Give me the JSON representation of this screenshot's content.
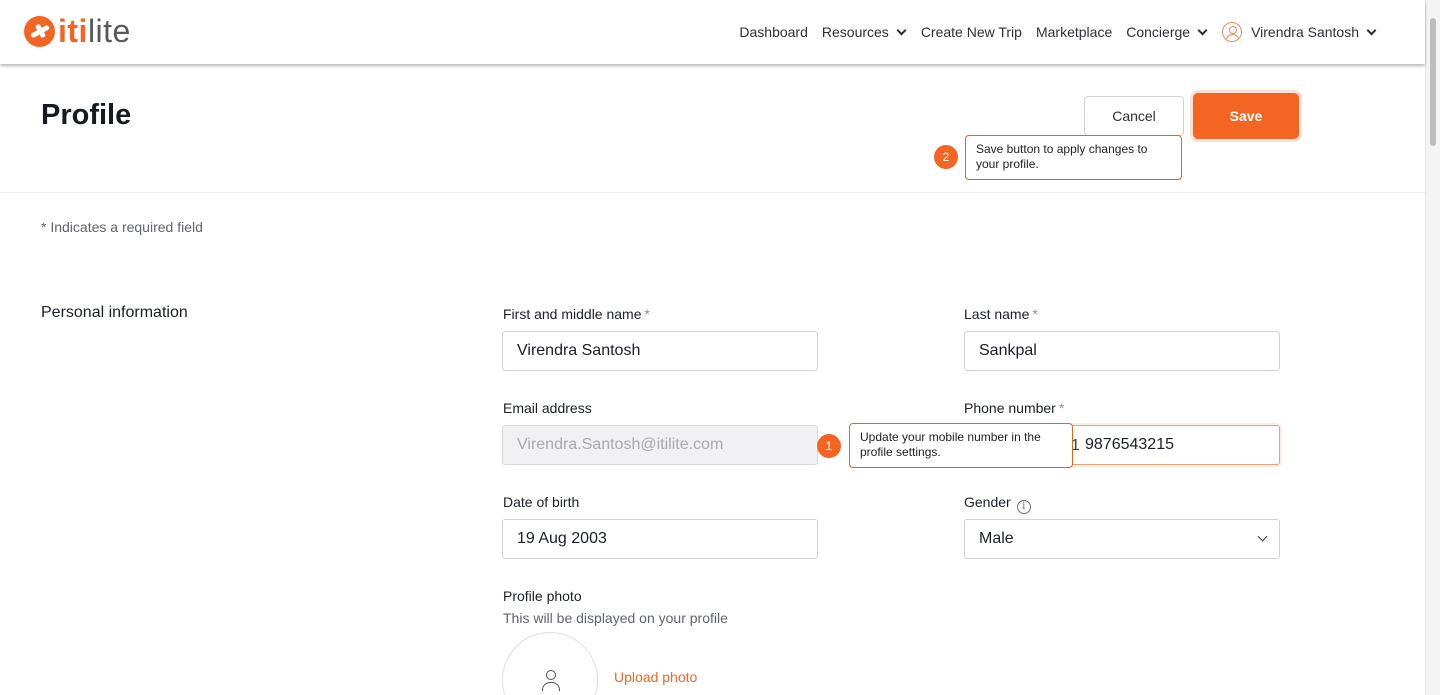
{
  "brand": {
    "prefix": "iti",
    "suffix": "lite",
    "accent": "#f26522"
  },
  "nav": {
    "dashboard": "Dashboard",
    "resources": "Resources",
    "create_trip": "Create New Trip",
    "marketplace": "Marketplace",
    "concierge": "Concierge",
    "user_name": "Virendra Santosh"
  },
  "page": {
    "title": "Profile",
    "cancel_label": "Cancel",
    "save_label": "Save",
    "required_note": "* Indicates a required field"
  },
  "tooltips": {
    "save": {
      "number": "2",
      "text": "Save button to apply changes to your profile."
    },
    "phone": {
      "number": "1",
      "text": "Update your mobile number in the profile settings."
    }
  },
  "personal": {
    "section_title": "Personal information",
    "first_name": {
      "label": "First and middle name",
      "required": "*",
      "value": "Virendra Santosh"
    },
    "last_name": {
      "label": "Last name",
      "required": "*",
      "value": "Sankpal"
    },
    "email": {
      "label": "Email address",
      "value": "Virendra.Santosh@itilite.com"
    },
    "phone": {
      "label": "Phone number",
      "required": "*",
      "code_fragment": "1",
      "value": "9876543215"
    },
    "dob": {
      "label": "Date of birth",
      "value": "19 Aug 2003"
    },
    "gender": {
      "label": "Gender",
      "info_glyph": "i",
      "value": "Male"
    },
    "photo": {
      "label": "Profile photo",
      "subtitle": "This will be displayed on your profile",
      "upload_label": "Upload photo"
    }
  }
}
